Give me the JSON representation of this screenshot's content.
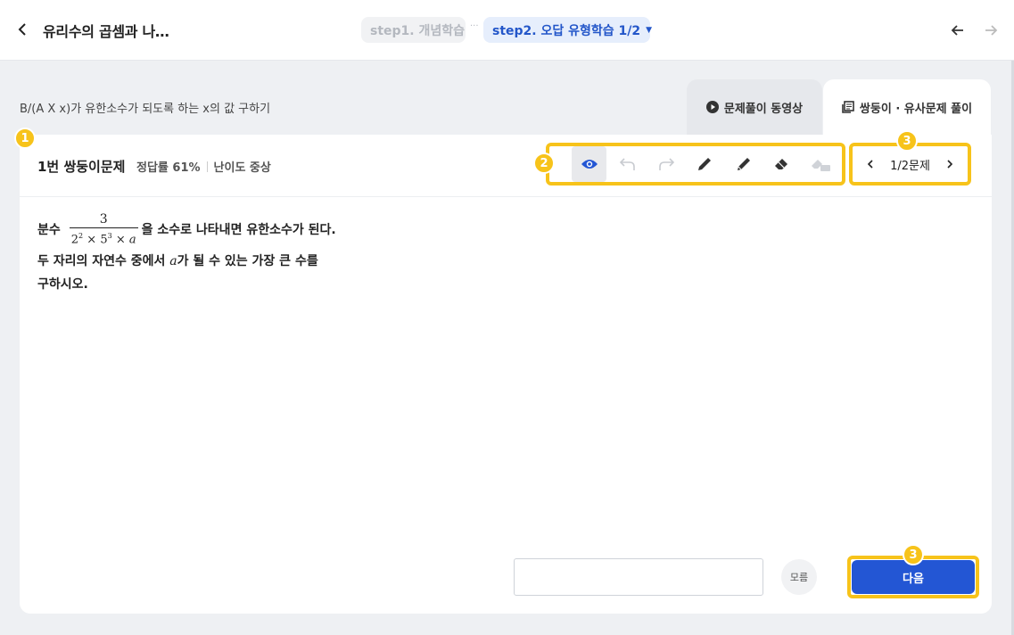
{
  "header": {
    "lesson_title": "유리수의 곱셈과 나…",
    "step1_label": "step1. 개념학습",
    "step_separator": "···",
    "step2_label": "step2. 오답 유형학습 1/2",
    "step2_caret": "▼"
  },
  "subheader": {
    "question_description": "B/(A X x)가 유한소수가 되도록 하는 x의 값 구하기",
    "tabs": [
      {
        "label": "문제풀이 동영상",
        "icon": "play-circle-icon"
      },
      {
        "label": "쌍둥이 · 유사문제 풀이",
        "icon": "copy-icon"
      }
    ]
  },
  "problem": {
    "title": "1번 쌍둥이문제",
    "accuracy": "정답률 61%",
    "difficulty": "난이도 중상",
    "text_before_fraction": "분수",
    "fraction_numerator": "3",
    "fraction_den_base1": "2",
    "fraction_den_exp1": "2",
    "fraction_den_base2": "5",
    "fraction_den_exp2": "3",
    "fraction_den_var": "a",
    "times_symbol": "×",
    "text_after_fraction": "을 소수로 나타내면 유한소수가 된다.",
    "line2_before_var": "두 자리의 자연수 중에서",
    "line2_var": "a",
    "line2_after_var": "가 될 수 있는 가장 큰 수를",
    "line3": "구하시오."
  },
  "toolbar": {
    "tools": [
      "eye-icon",
      "undo-icon",
      "redo-icon",
      "pen-icon",
      "pencil-icon",
      "eraser-icon",
      "clear-all-icon"
    ],
    "active_tool": "eye-icon"
  },
  "pager": {
    "label": "1/2문제"
  },
  "answer": {
    "value": "",
    "dont_know_label": "모름",
    "next_label": "다음"
  },
  "badges": {
    "b1": "1",
    "b2": "2",
    "b3a": "3",
    "b3b": "3"
  },
  "colors": {
    "accent": "#2356d4",
    "highlight": "#f7c31a",
    "step2_bg": "#e6eefc"
  }
}
